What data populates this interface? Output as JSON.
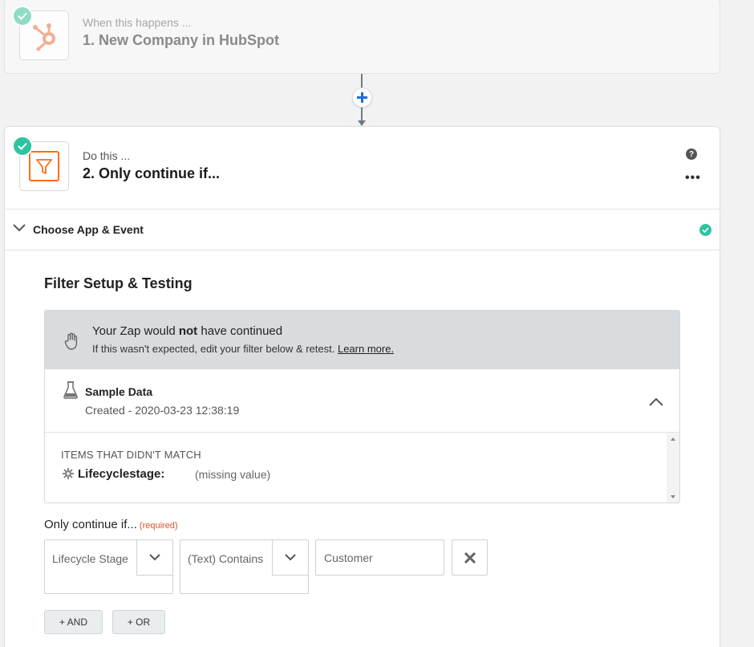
{
  "step1": {
    "kicker": "When this happens ...",
    "title": "1. New Company in HubSpot",
    "app_icon": "hubspot-icon",
    "status_icon": "check-icon"
  },
  "connector": {
    "add_icon": "plus-icon"
  },
  "step2": {
    "kicker": "Do this ...",
    "title": "2. Only continue if...",
    "app_icon": "filter-icon",
    "status_icon": "check-icon",
    "help_label": "?",
    "more_label": "•••"
  },
  "section": {
    "label": "Choose App & Event",
    "chevron_icon": "chevron-down-icon",
    "status_icon": "check-icon"
  },
  "filter": {
    "heading": "Filter Setup & Testing",
    "banner": {
      "main_prefix": "Your Zap would ",
      "main_bold": "not",
      "main_suffix": " have continued",
      "sub_text": "If this wasn't expected, edit your filter below & retest. ",
      "link": "Learn more."
    },
    "sample": {
      "title": "Sample Data",
      "created": "Created - 2020-03-23 12:38:19"
    },
    "items": {
      "label": "ITEMS THAT DIDN'T MATCH",
      "key": "Lifecyclestage:",
      "value": "(missing value)"
    },
    "condition": {
      "label": "Only continue if...",
      "required": "(required)",
      "field": "Lifecycle Stage",
      "operator": "(Text) Contains",
      "value": "Customer",
      "and_label": "+ AND",
      "or_label": "+ OR"
    }
  },
  "colors": {
    "accent_green": "#2ec4a0",
    "hubspot_orange": "#ff7a59",
    "filter_orange": "#ff6b1a",
    "banner_gray": "#d9dcde",
    "required_red": "#d2542a"
  }
}
